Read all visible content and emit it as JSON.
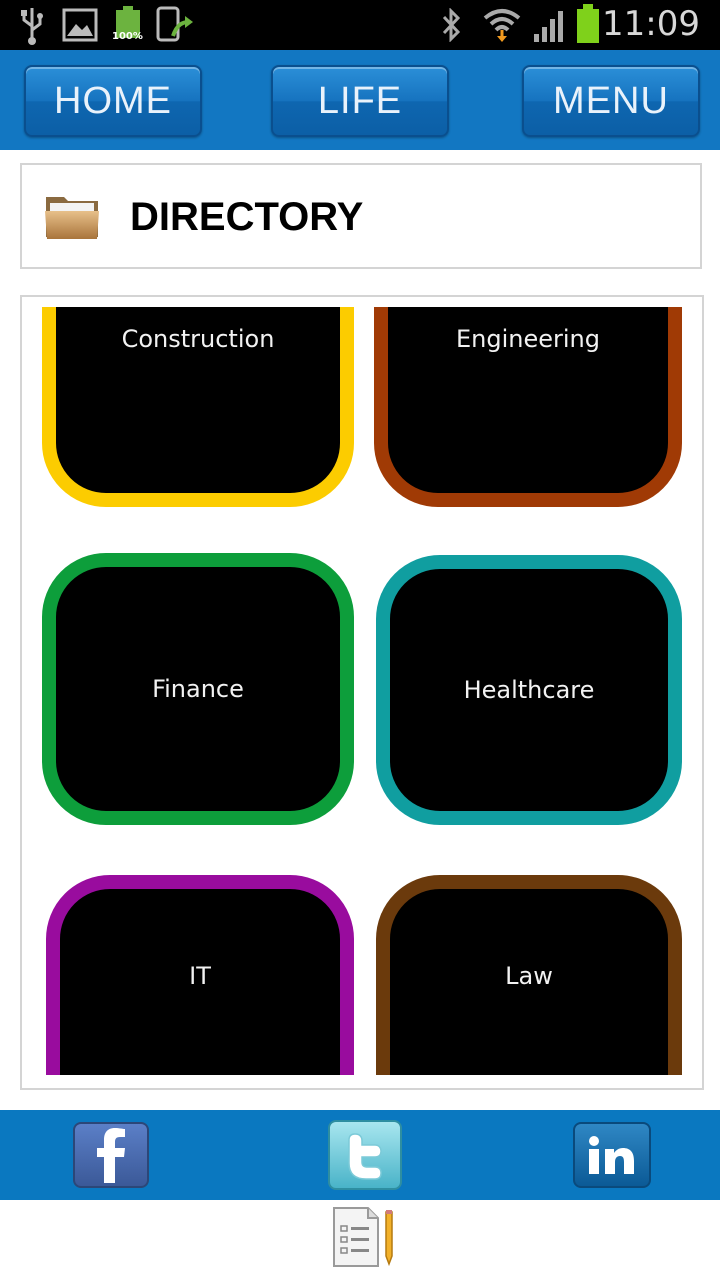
{
  "status_bar": {
    "battery_percent": "100%",
    "time": "11:09"
  },
  "nav": {
    "home_label": "HOME",
    "life_label": "LIFE",
    "menu_label": "MENU"
  },
  "directory": {
    "title": "DIRECTORY"
  },
  "categories": [
    {
      "label": "Construction",
      "color": "#fccc00"
    },
    {
      "label": "Engineering",
      "color": "#a03a05"
    },
    {
      "label": "Finance",
      "color": "#0d9e3b"
    },
    {
      "label": "Healthcare",
      "color": "#109ea0"
    },
    {
      "label": "IT",
      "color": "#990c9e"
    },
    {
      "label": "Law",
      "color": "#6b3a0c"
    }
  ],
  "social": {
    "icons": [
      "facebook-icon",
      "twitter-icon",
      "linkedin-icon"
    ]
  },
  "colors": {
    "nav_blue": "#1277c2",
    "social_blue": "#0a78c0"
  }
}
